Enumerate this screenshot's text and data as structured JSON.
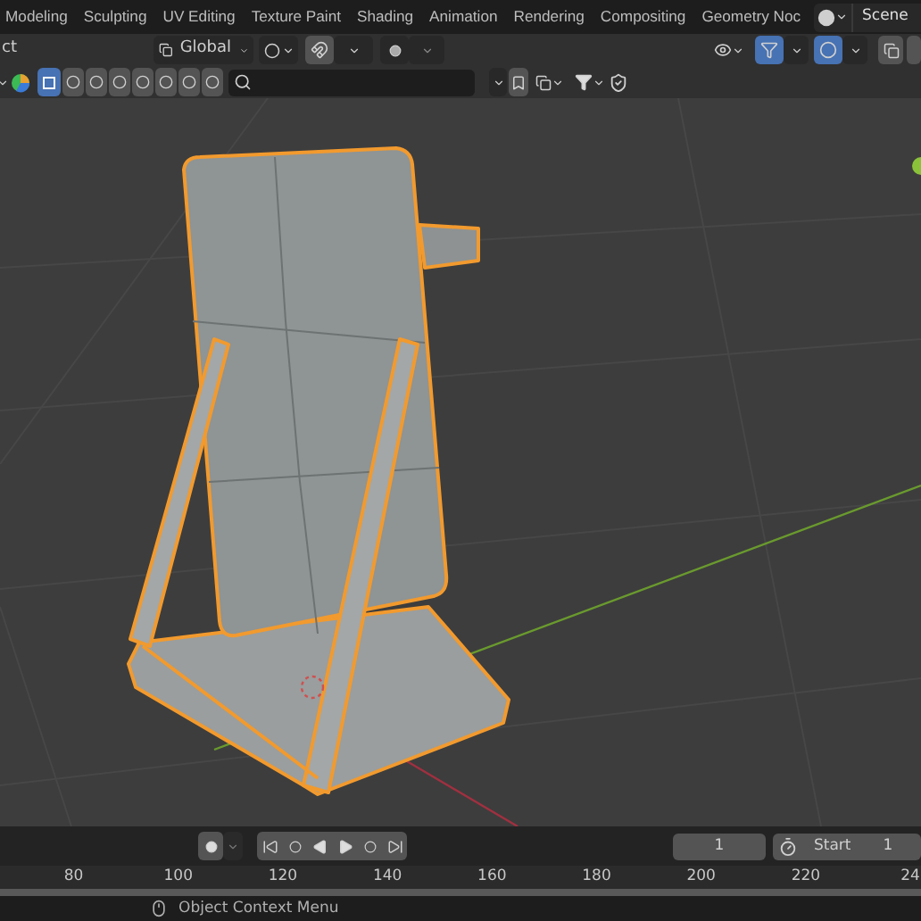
{
  "workspace_tabs": [
    {
      "label": "Modeling",
      "selected": false
    },
    {
      "label": "Sculpting",
      "selected": false
    },
    {
      "label": "UV Editing",
      "selected": false
    },
    {
      "label": "Texture Paint",
      "selected": false
    },
    {
      "label": "Shading",
      "selected": false
    },
    {
      "label": "Animation",
      "selected": false
    },
    {
      "label": "Rendering",
      "selected": false
    },
    {
      "label": "Compositing",
      "selected": false
    },
    {
      "label": "Geometry Noc",
      "selected": false
    }
  ],
  "scene": "Scene",
  "viewport_header": {
    "mode": "ct",
    "orientation": "Global",
    "gizmos_on": true,
    "overlays_on": true
  },
  "timeline": {
    "current_frame": "1",
    "start_label": "Start",
    "start_value": "1",
    "ruler": [
      "80",
      "100",
      "120",
      "140",
      "160",
      "180",
      "200",
      "220",
      "24"
    ]
  },
  "status_bar": {
    "hint": "Object Context Menu"
  }
}
